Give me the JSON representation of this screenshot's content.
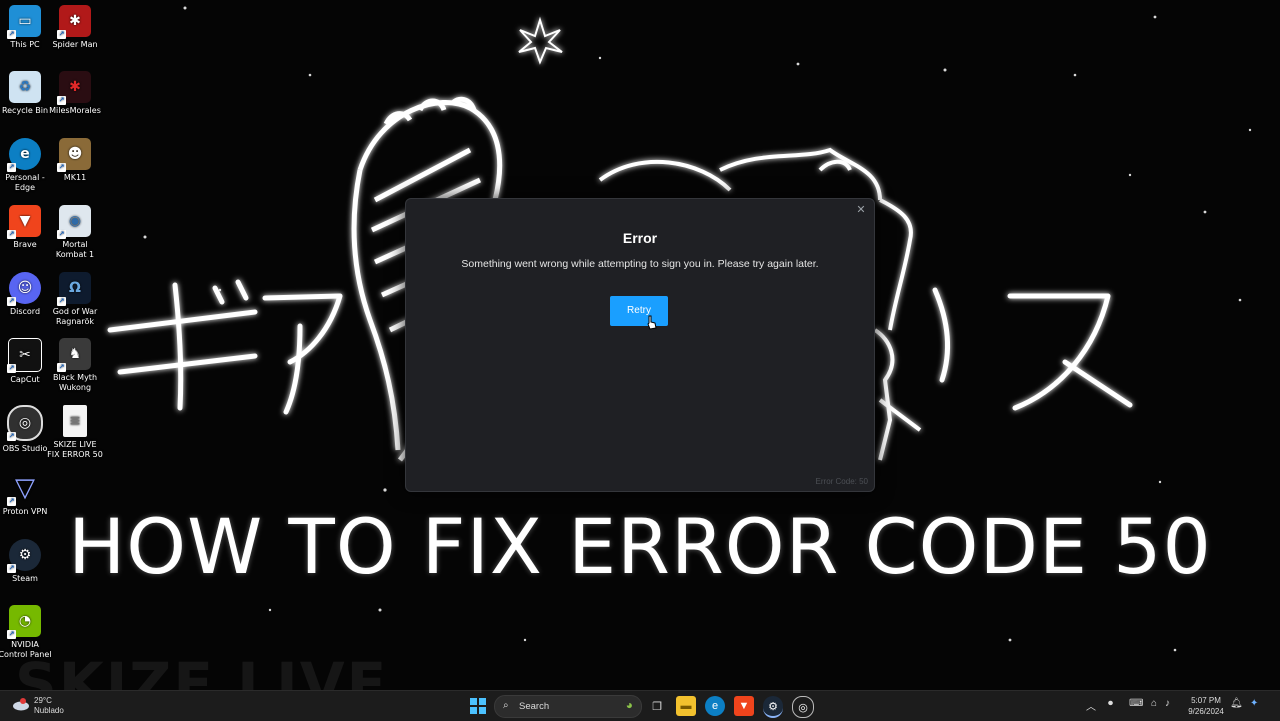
{
  "desktop": {
    "icons": [
      {
        "label": "This PC"
      },
      {
        "label": "Spider Man"
      },
      {
        "label": "Recycle Bin"
      },
      {
        "label": "MilesMorales"
      },
      {
        "label": "Personal - Edge"
      },
      {
        "label": "MK11"
      },
      {
        "label": "Brave"
      },
      {
        "label": "Mortal Kombat 1"
      },
      {
        "label": "Discord"
      },
      {
        "label": "God of War Ragnarök"
      },
      {
        "label": "CapCut"
      },
      {
        "label": "Black Myth Wukong"
      },
      {
        "label": "OBS Studio"
      },
      {
        "label": "SKIZE LIVE FIX ERROR 50"
      },
      {
        "label": "Proton VPN"
      },
      {
        "label": "Steam"
      },
      {
        "label": "NVIDIA Control Panel"
      }
    ]
  },
  "wallpaper": {
    "kana": "ギア　ックス",
    "headline": "HOW TO FIX ERROR CODE 50",
    "watermark": "SKIZE LIVE"
  },
  "dialog": {
    "title": "Error",
    "message": "Something went wrong while attempting to sign you in. Please try again later.",
    "retry_label": "Retry",
    "close_icon": "close-icon",
    "code_text": "Error Code: 50",
    "accent_color": "#1a9fff"
  },
  "taskbar": {
    "weather_temp": "29°C",
    "weather_condition": "Nublado",
    "search_placeholder": "Search",
    "clock_time": "5:07 PM",
    "clock_date": "9/26/2024"
  }
}
